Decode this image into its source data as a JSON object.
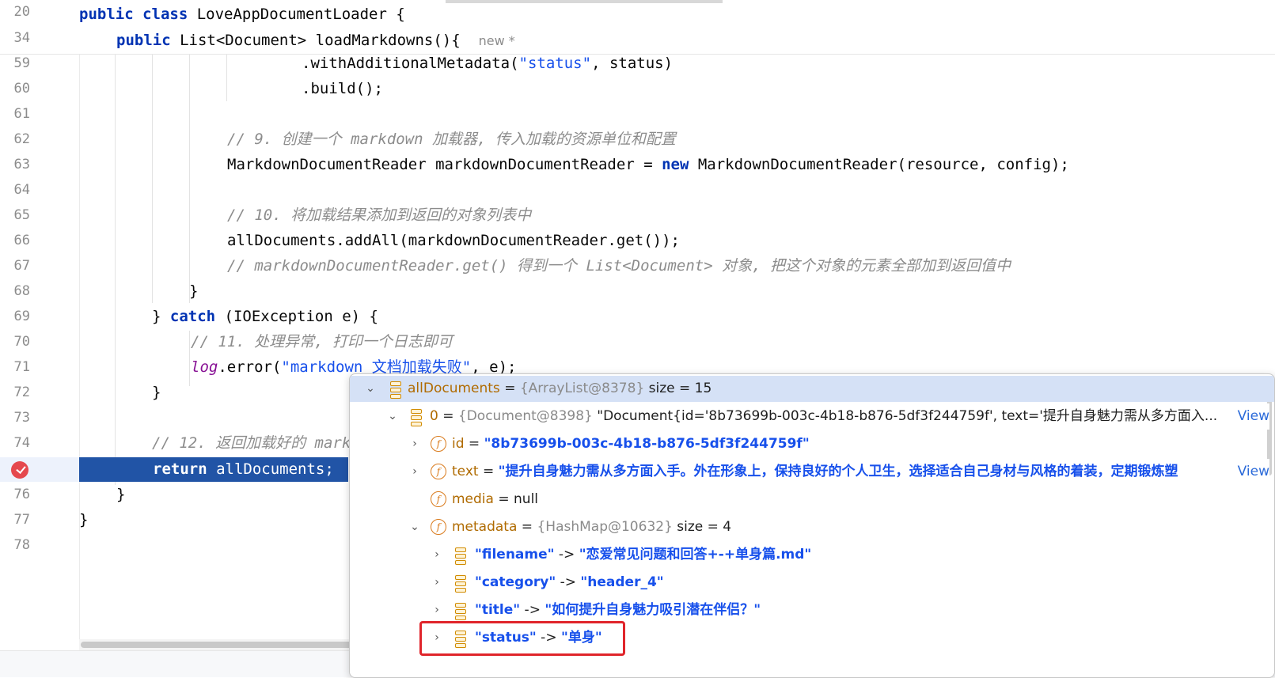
{
  "sticky": {
    "lines": [
      {
        "num": "20",
        "kw": "public class",
        "rest": " LoveAppDocumentLoader {"
      },
      {
        "num": "34",
        "kw": "public",
        "rest": " List<Document> loadMarkdowns(){",
        "hint": "new *"
      }
    ]
  },
  "code": {
    "l59": {
      "num": "59",
      "pre": ".withAdditionalMetadata(",
      "str": "\"status\"",
      "post": ", status)"
    },
    "l60": {
      "num": "60",
      "text": ".build();"
    },
    "l61": {
      "num": "61"
    },
    "l62": {
      "num": "62",
      "comment": "// 9. 创建一个 markdown 加载器, 传入加载的资源单位和配置"
    },
    "l63": {
      "num": "63",
      "pre": "MarkdownDocumentReader markdownDocumentReader = ",
      "kw": "new",
      "post": " MarkdownDocumentReader(resource, config);"
    },
    "l64": {
      "num": "64"
    },
    "l65": {
      "num": "65",
      "comment": "// 10. 将加载结果添加到返回的对象列表中"
    },
    "l66": {
      "num": "66",
      "text": "allDocuments.addAll(markdownDocumentReader.get());"
    },
    "l67": {
      "num": "67",
      "comment": "// markdownDocumentReader.get() 得到一个 List<Document> 对象, 把这个对象的元素全部加到返回值中"
    },
    "l68": {
      "num": "68",
      "text": "}"
    },
    "l69": {
      "num": "69",
      "pre": "} ",
      "kw": "catch",
      "post": " (IOException e) {"
    },
    "l70": {
      "num": "70",
      "comment": "// 11. 处理异常, 打印一个日志即可"
    },
    "l71": {
      "num": "71",
      "fld": "log",
      "pre": ".error(",
      "str": "\"markdown 文档加载失败\"",
      "post": ", e);"
    },
    "l72": {
      "num": "72",
      "text": "}"
    },
    "l73": {
      "num": "73"
    },
    "l74": {
      "num": "74",
      "comment": "// 12. 返回加载好的 mark"
    },
    "l75": {
      "num": "75",
      "kw": "return",
      "post": " allDocuments;"
    },
    "l76": {
      "num": "76",
      "text": "}"
    },
    "l77": {
      "num": "77",
      "text": "}"
    },
    "l78": {
      "num": "78"
    }
  },
  "debug": {
    "root": {
      "name": "allDocuments",
      "eq": " = ",
      "ref": "{ArrayList@8378}",
      "extra": "  size = 15"
    },
    "item0": {
      "name": "0",
      "eq": " = ",
      "ref": "{Document@8398}",
      "value": " \"Document{id='8b73699b-003c-4b18-b876-5df3f244759f', text='提升自身魅力需从多方面入...",
      "view": "View"
    },
    "id": {
      "name": "id",
      "eq": " = ",
      "value": "\"8b73699b-003c-4b18-b876-5df3f244759f\""
    },
    "text": {
      "name": "text",
      "eq": " = ",
      "value": "\"提升自身魅力需从多方面入手。外在形象上，保持良好的个人卫生，选择适合自己身材与风格的着装，定期锻炼塑",
      "view": "View"
    },
    "media": {
      "name": "media",
      "eq": " = ",
      "value": "null"
    },
    "metadata": {
      "name": "metadata",
      "eq": " = ",
      "ref": "{HashMap@10632}",
      "extra": "  size = 4"
    },
    "entries": [
      {
        "key": "\"filename\"",
        "arrow": " -> ",
        "value": "\"恋爱常见问题和回答+-+单身篇.md\""
      },
      {
        "key": "\"category\"",
        "arrow": " -> ",
        "value": "\"header_4\""
      },
      {
        "key": "\"title\"",
        "arrow": " -> ",
        "value": "\"如何提升自身魅力吸引潜在伴侣？\""
      },
      {
        "key": "\"status\"",
        "arrow": " -> ",
        "value": "\"单身\""
      }
    ]
  },
  "colors": {
    "keyword": "#0033b3",
    "string": "#067d17",
    "comment": "#8c8c8c",
    "execution_line": "#2154a6",
    "breakpoint": "#e5484d",
    "highlight_box": "#e0252b"
  }
}
